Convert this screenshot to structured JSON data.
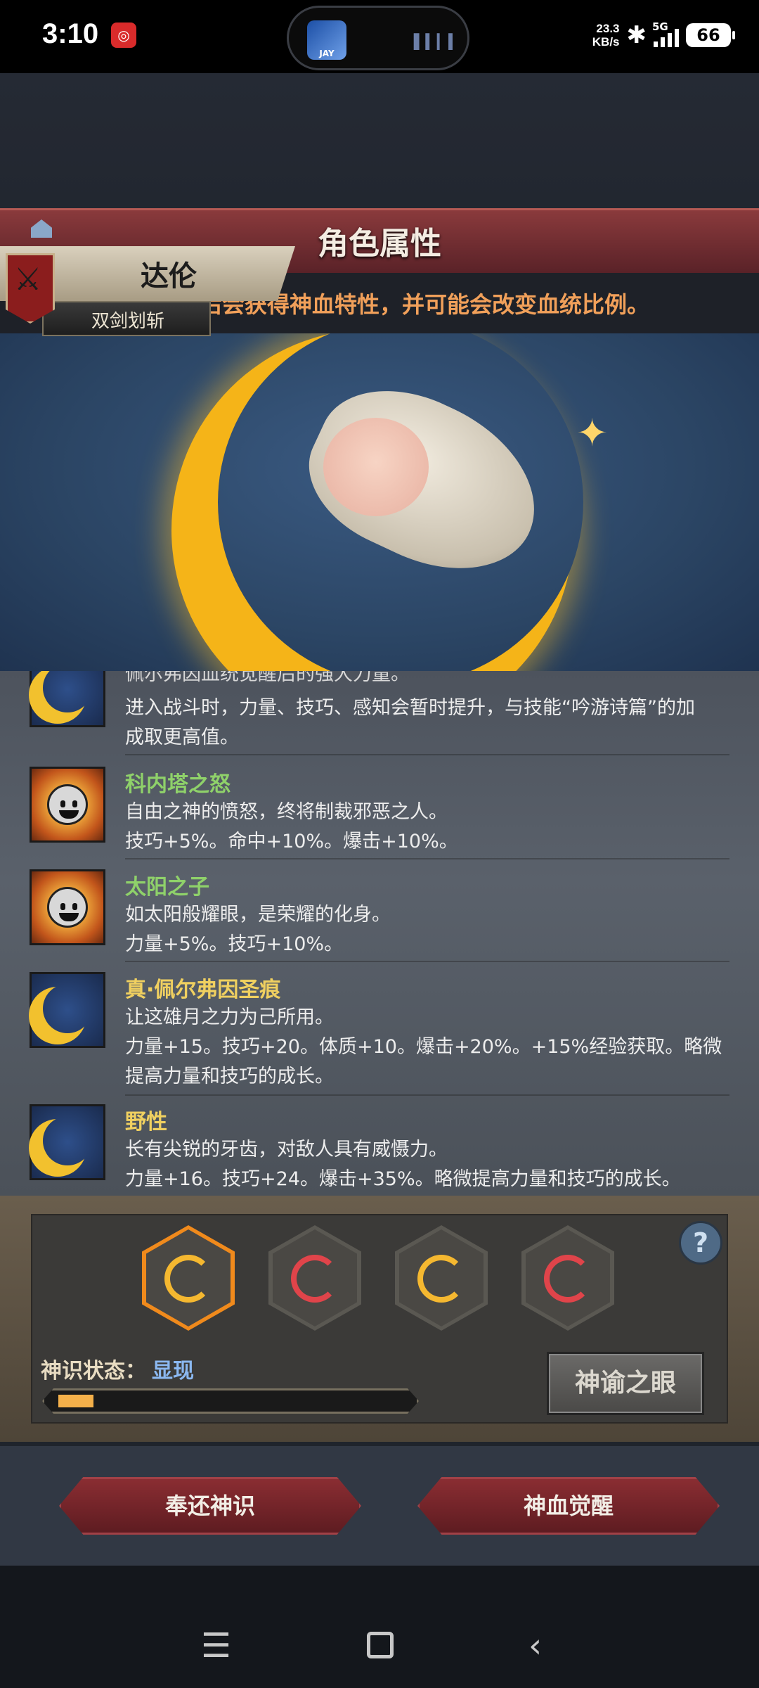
{
  "status_bar": {
    "time": "3:10",
    "notification_badge": "🔙",
    "island_thumb_text": "JAY",
    "network_speed_value": "23.3",
    "network_speed_unit": "KB/s",
    "network_type": "5G",
    "battery": "66"
  },
  "header": {
    "title": "角色属性",
    "tip": "神血觉醒后会获得神血特性，并可能会改变血统比例。"
  },
  "character": {
    "name": "达伦",
    "title": "双剑划斩"
  },
  "traits": [
    {
      "icon": "moon-icon",
      "name": "",
      "name_color": "#8fd16a",
      "lines": [
        "佩尔弗因血统觉醒后的强大力量。",
        "进入战斗时，力量、技巧、感知会暂时提升，与技能“吟游诗篇”的加",
        "成取更高值。"
      ]
    },
    {
      "icon": "sun-face-icon",
      "name": "科内塔之怒",
      "name_color": "#8fd16a",
      "lines": [
        "自由之神的愤怒，终将制裁邪恶之人。",
        "技巧+5%。命中+10%。爆击+10%。"
      ]
    },
    {
      "icon": "sun-face-icon",
      "name": "太阳之子",
      "name_color": "#8fd16a",
      "lines": [
        "如太阳般耀眼，是荣耀的化身。",
        "力量+5%。技巧+10%。"
      ]
    },
    {
      "icon": "moon-icon",
      "name": "真·佩尔弗因圣痕",
      "name_color": "#f0d060",
      "lines": [
        "让这雄月之力为己所用。",
        "力量+15。技巧+20。体质+10。爆击+20%。+15%经验获取。略微",
        "提高力量和技巧的成长。"
      ]
    },
    {
      "icon": "moon-icon",
      "name": "野性",
      "name_color": "#f0d060",
      "lines": [
        "长有尖锐的牙齿，对敌人具有威慑力。",
        "力量+16。技巧+24。爆击+35%。略微提高力量和技巧的成长。"
      ]
    }
  ],
  "awakening": {
    "slots": [
      {
        "color": "#f5b830",
        "active": true
      },
      {
        "color": "#e0444a",
        "active": false
      },
      {
        "color": "#f5b830",
        "active": false
      },
      {
        "color": "#e0444a",
        "active": false
      }
    ],
    "help_label": "?",
    "status_label": "神识状态：",
    "status_value": "显现",
    "progress": 0.1,
    "eye_button": "神谕之眼"
  },
  "actions": {
    "return_button": "奉还神识",
    "awaken_button": "神血觉醒"
  },
  "colors": {
    "accent_red": "#8a2d32",
    "tip_orange": "#f1a05a",
    "moon_gold": "#f5b418"
  }
}
